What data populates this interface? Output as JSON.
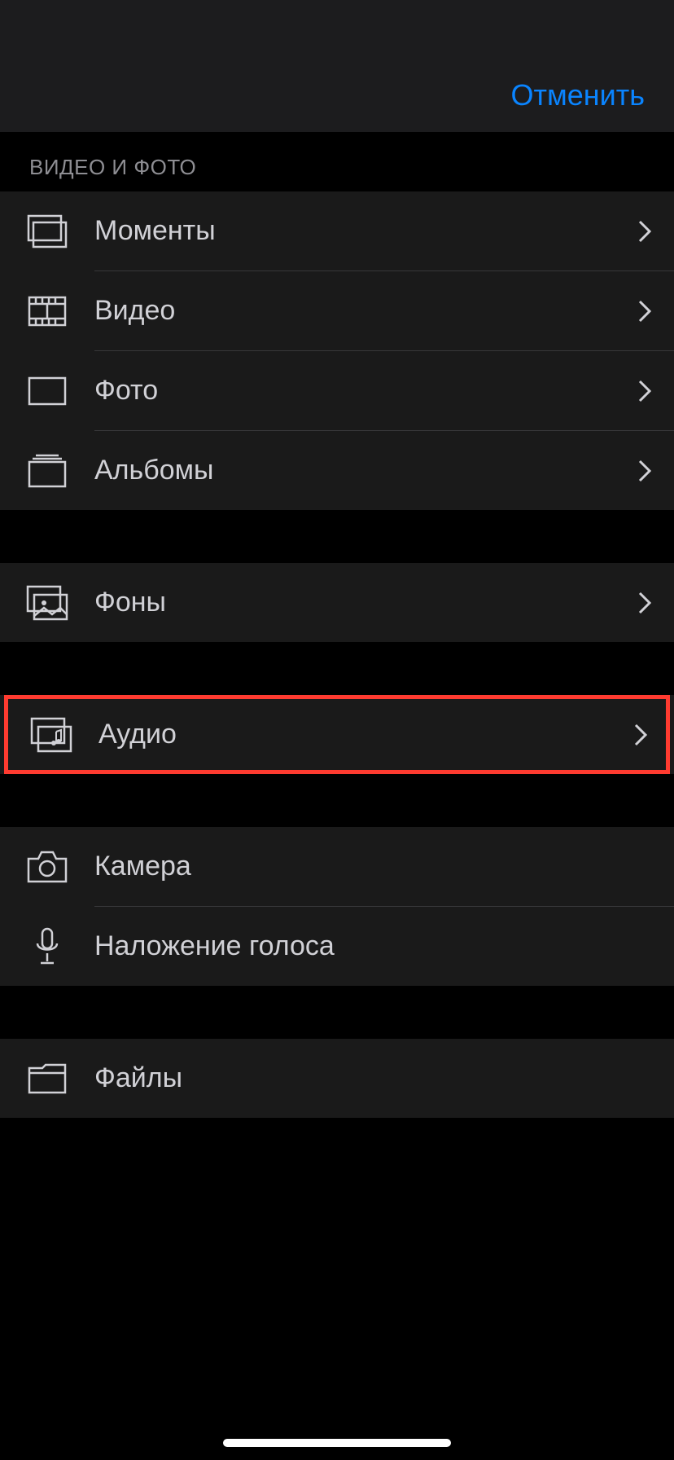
{
  "header": {
    "cancel": "Отменить"
  },
  "sections": {
    "videoPhoto": {
      "title": "ВИДЕО И ФОТО",
      "moments": "Моменты",
      "video": "Видео",
      "photo": "Фото",
      "albums": "Альбомы"
    },
    "backgrounds": "Фоны",
    "audio": "Аудио",
    "camera": "Камера",
    "voiceover": "Наложение голоса",
    "files": "Файлы"
  }
}
